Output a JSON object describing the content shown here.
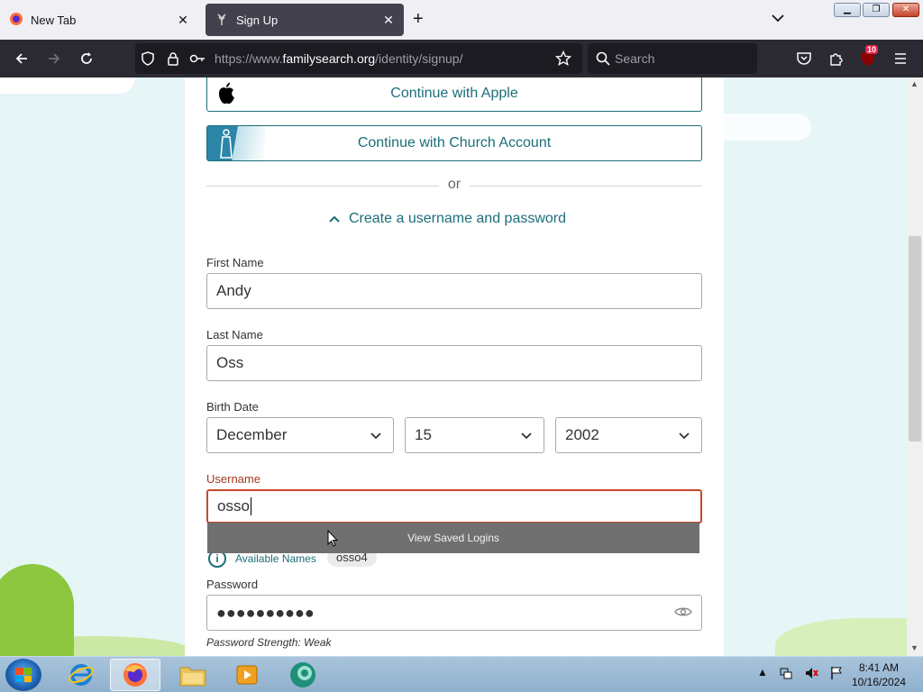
{
  "browser": {
    "tabs": [
      {
        "label": "New Tab"
      },
      {
        "label": "Sign Up"
      }
    ],
    "url_prefix": "https://www.",
    "url_host": "familysearch.org",
    "url_path": "/identity/signup/",
    "search_placeholder": "Search",
    "extension_badge": "10"
  },
  "signup": {
    "apple_label": "Continue with Apple",
    "church_label": "Continue with Church Account",
    "or_text": "or",
    "collapse_label": "Create a username and password",
    "first_name_label": "First Name",
    "first_name_value": "Andy",
    "last_name_label": "Last Name",
    "last_name_value": "Oss",
    "birth_date_label": "Birth Date",
    "birth_month": "December",
    "birth_day": "15",
    "birth_year": "2002",
    "username_label": "Username",
    "username_value": "osso",
    "saved_logins": "View Saved Logins",
    "available_names_label": "Available Names",
    "available_name_1": "osso4",
    "password_label": "Password",
    "password_mask": "●●●●●●●●●●",
    "password_strength": "Password Strength: Weak"
  },
  "taskbar": {
    "time": "8:41 AM",
    "date": "10/16/2024"
  },
  "colors": {
    "accent": "#1c6e7a",
    "error": "#c6492a",
    "page_bg": "#e6f5f5"
  }
}
